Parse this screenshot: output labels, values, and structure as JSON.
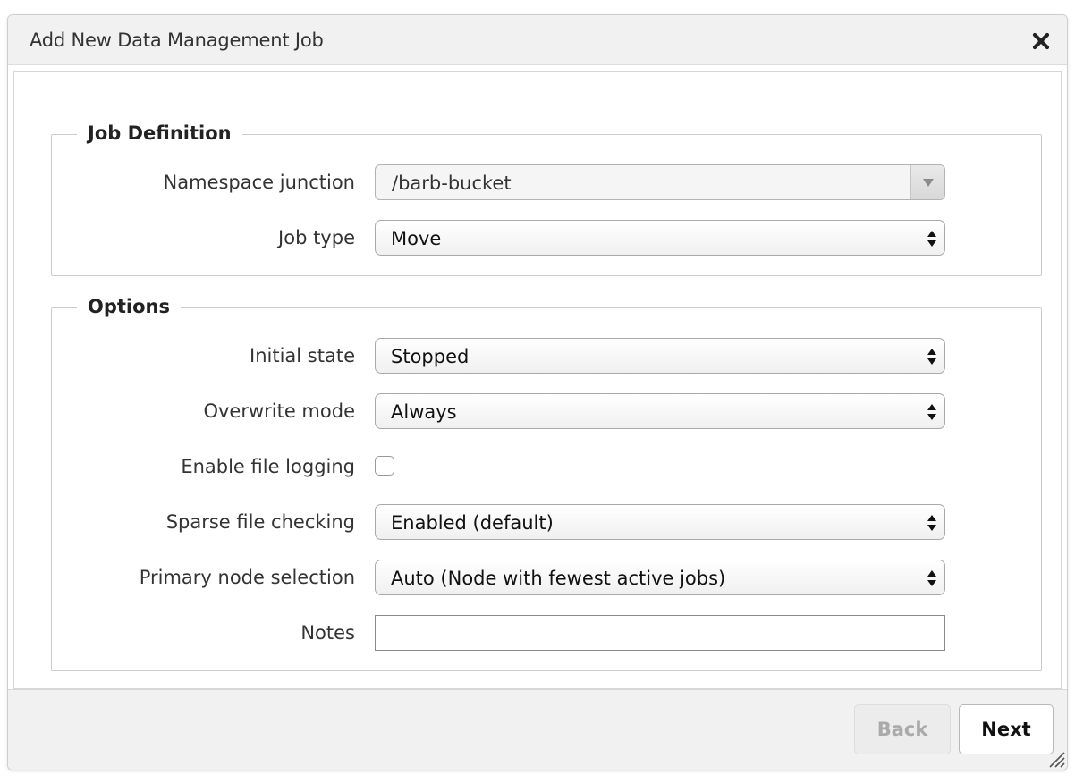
{
  "dialog": {
    "title": "Add New Data Management Job",
    "close_icon": "close-x-icon"
  },
  "job_definition": {
    "legend": "Job Definition",
    "namespace_junction": {
      "label": "Namespace junction",
      "value": "/barb-bucket"
    },
    "job_type": {
      "label": "Job type",
      "value": "Move"
    }
  },
  "options": {
    "legend": "Options",
    "initial_state": {
      "label": "Initial state",
      "value": "Stopped"
    },
    "overwrite_mode": {
      "label": "Overwrite mode",
      "value": "Always"
    },
    "enable_file_logging": {
      "label": "Enable file logging",
      "checked": false
    },
    "sparse_file_checking": {
      "label": "Sparse file checking",
      "value": "Enabled (default)"
    },
    "primary_node_selection": {
      "label": "Primary node selection",
      "value": "Auto (Node with fewest active jobs)"
    },
    "notes": {
      "label": "Notes",
      "value": ""
    }
  },
  "footer": {
    "back_label": "Back",
    "next_label": "Next"
  }
}
